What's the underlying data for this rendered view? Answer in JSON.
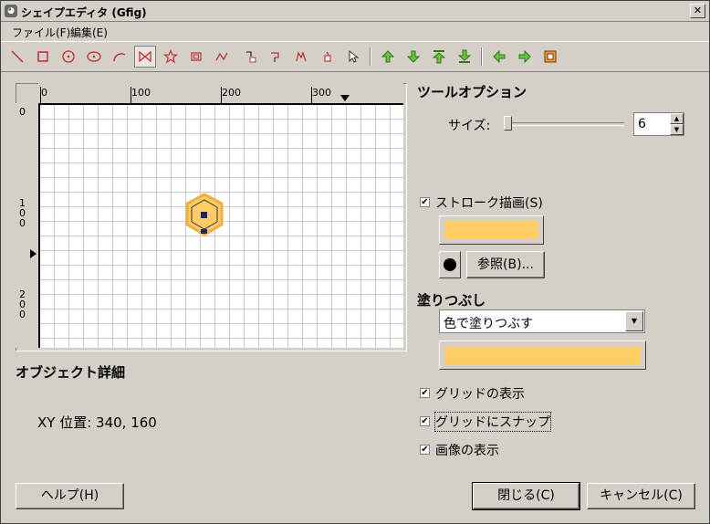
{
  "window": {
    "title": "シェイプエディタ (Gfig)"
  },
  "menu": [
    {
      "label": "ファイル(F)"
    },
    {
      "label": "編集(E)"
    }
  ],
  "ruler": {
    "h_labels": [
      "0",
      "100",
      "200",
      "300"
    ],
    "v_labels": [
      "0",
      "1\n0\n0",
      "2\n0\n0"
    ]
  },
  "object_details": {
    "title": "オブジェクト詳細",
    "position_label": "XY 位置: 340, 160"
  },
  "tool_options": {
    "title": "ツールオプション",
    "size_label": "サイズ:",
    "size_value": "6",
    "stroke_label": "ストローク描画(S)",
    "stroke_checked": true,
    "stroke_color": "#ffcc66",
    "browse_label": "参照(B)...",
    "fill_title": "塗りつぶし",
    "fill_option": "色で塗りつぶす",
    "fill_color": "#ffcc66",
    "show_grid_label": "グリッドの表示",
    "snap_grid_label": "グリッドにスナップ",
    "show_image_label": "画像の表示"
  },
  "buttons": {
    "help": "ヘルプ(H)",
    "close": "閉じる(C)",
    "cancel": "キャンセル(C)"
  },
  "colors": {
    "shape_fill": "#ffcc66",
    "handle": "#1a2a4a"
  }
}
